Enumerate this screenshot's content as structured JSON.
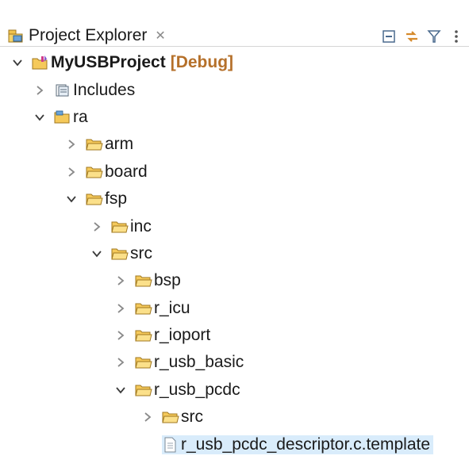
{
  "view": {
    "title": "Project Explorer",
    "close_glyph": "✕",
    "toolbar": [
      {
        "name": "collapse-all-icon"
      },
      {
        "name": "link-with-editor-icon"
      },
      {
        "name": "filter-icon"
      },
      {
        "name": "view-menu-icon"
      }
    ]
  },
  "tree": {
    "project": {
      "name": "MyUSBProject",
      "config": "[Debug]"
    },
    "nodes": [
      {
        "label": "Includes",
        "expanded": false
      },
      {
        "label": "ra",
        "expanded": true
      },
      {
        "label": "arm",
        "expanded": false
      },
      {
        "label": "board",
        "expanded": false
      },
      {
        "label": "fsp",
        "expanded": true
      },
      {
        "label": "inc",
        "expanded": false
      },
      {
        "label": "src",
        "expanded": true
      },
      {
        "label": "bsp",
        "expanded": false
      },
      {
        "label": "r_icu",
        "expanded": false
      },
      {
        "label": "r_ioport",
        "expanded": false
      },
      {
        "label": "r_usb_basic",
        "expanded": false
      },
      {
        "label": "r_usb_pcdc",
        "expanded": true
      },
      {
        "label": "src",
        "expanded": false
      },
      {
        "label": "r_usb_pcdc_descriptor.c.template",
        "selected": true
      }
    ]
  },
  "colors": {
    "folder": "#e8b13a",
    "selection": "#d9ecfb",
    "config": "#b5702a"
  }
}
